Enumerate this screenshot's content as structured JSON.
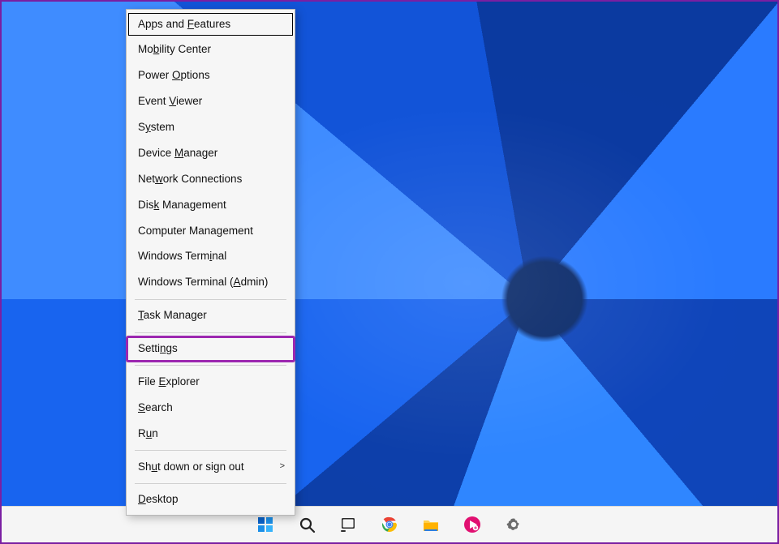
{
  "menu": {
    "items": [
      {
        "pre": "Apps and ",
        "acc": "F",
        "post": "eatures",
        "kbfocus": true
      },
      {
        "pre": "Mo",
        "acc": "b",
        "post": "ility Center"
      },
      {
        "pre": "Power ",
        "acc": "O",
        "post": "ptions"
      },
      {
        "pre": "Event ",
        "acc": "V",
        "post": "iewer"
      },
      {
        "pre": "S",
        "acc": "y",
        "post": "stem"
      },
      {
        "pre": "Device ",
        "acc": "M",
        "post": "anager"
      },
      {
        "pre": "Net",
        "acc": "w",
        "post": "ork Connections"
      },
      {
        "pre": "Dis",
        "acc": "k",
        "post": " Management"
      },
      {
        "pre": "Computer Mana",
        "acc": "g",
        "post": "ement"
      },
      {
        "pre": "Windows Term",
        "acc": "i",
        "post": "nal"
      },
      {
        "pre": "Windows Terminal (",
        "acc": "A",
        "post": "dmin)"
      },
      "sep",
      {
        "pre": "",
        "acc": "T",
        "post": "ask Manager"
      },
      "sep",
      {
        "pre": "Setti",
        "acc": "n",
        "post": "gs",
        "highlight": true
      },
      "sep",
      {
        "pre": "File ",
        "acc": "E",
        "post": "xplorer"
      },
      {
        "pre": "",
        "acc": "S",
        "post": "earch"
      },
      {
        "pre": "R",
        "acc": "u",
        "post": "n"
      },
      "sep",
      {
        "pre": "Sh",
        "acc": "u",
        "post": "t down or sign out",
        "submenu": true
      },
      "sep",
      {
        "pre": "",
        "acc": "D",
        "post": "esktop"
      }
    ]
  },
  "taskbar": {
    "buttons": [
      {
        "name": "start-button",
        "icon": "start-icon"
      },
      {
        "name": "search-button",
        "icon": "search-icon"
      },
      {
        "name": "task-view-button",
        "icon": "task-view-icon"
      },
      {
        "name": "chrome-button",
        "icon": "chrome-icon"
      },
      {
        "name": "file-explorer-button",
        "icon": "folder-icon"
      },
      {
        "name": "app-button",
        "icon": "pink-app-icon"
      },
      {
        "name": "settings-button",
        "icon": "gear-icon"
      }
    ]
  },
  "submenu_arrow": ">"
}
